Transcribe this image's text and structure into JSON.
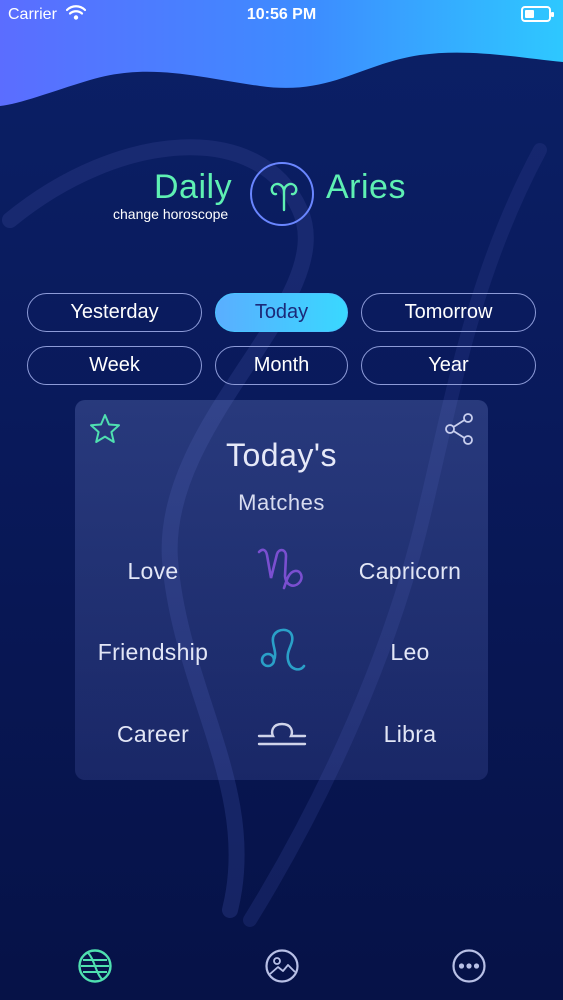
{
  "status_bar": {
    "carrier": "Carrier",
    "time": "10:56 PM",
    "icons": [
      "wifi-icon",
      "battery-icon"
    ]
  },
  "header": {
    "daily_label": "Daily",
    "sign_label": "Aries",
    "change_link": "change horoscope",
    "sign_icon": "aries-icon"
  },
  "periods": {
    "row1": [
      "Yesterday",
      "Today",
      "Tomorrow"
    ],
    "row2": [
      "Week",
      "Month",
      "Year"
    ],
    "selected": "Today"
  },
  "card": {
    "title": "Today's",
    "subtitle": "Matches",
    "icons": [
      "star-icon",
      "share-icon"
    ],
    "matches": [
      {
        "category": "Love",
        "sign": "Capricorn",
        "icon": "capricorn-icon",
        "color": "#7a4fd0"
      },
      {
        "category": "Friendship",
        "sign": "Leo",
        "icon": "leo-icon",
        "color": "#2aa0c8"
      },
      {
        "category": "Career",
        "sign": "Libra",
        "icon": "libra-icon",
        "color": "#d0d4ea"
      }
    ]
  },
  "tab_bar": {
    "tabs": [
      "horoscope-tab-icon",
      "gallery-tab-icon",
      "more-tab-icon"
    ],
    "active": "horoscope-tab-icon"
  },
  "colors": {
    "accent_green": "#5ef0b3",
    "accent_blue": "#39d8ff",
    "background": "#09195a"
  }
}
